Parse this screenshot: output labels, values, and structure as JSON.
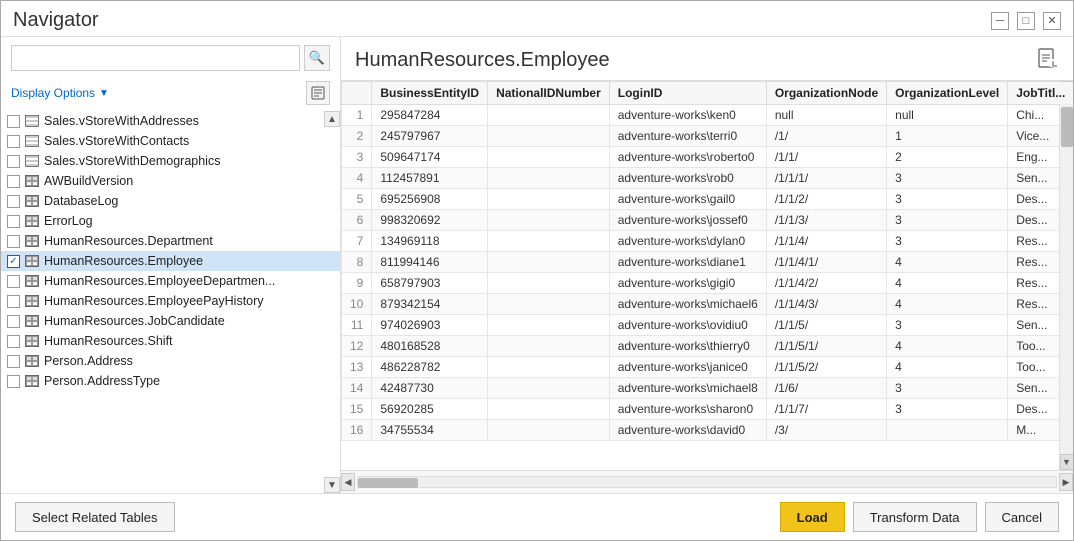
{
  "window": {
    "title": "Navigator",
    "minimize_label": "─",
    "restore_label": "□",
    "close_label": "✕"
  },
  "search": {
    "placeholder": "",
    "value": ""
  },
  "display_options": {
    "label": "Display Options",
    "arrow": "▼"
  },
  "tree": {
    "items": [
      {
        "id": "SalesVStoreWithAddresses",
        "label": "Sales.vStoreWithAddresses",
        "type": "view",
        "checked": false,
        "selected": false
      },
      {
        "id": "SalesVStoreWithContacts",
        "label": "Sales.vStoreWithContacts",
        "type": "view",
        "checked": false,
        "selected": false
      },
      {
        "id": "SalesVStoreWithDemographics",
        "label": "Sales.vStoreWithDemographics",
        "type": "view",
        "checked": false,
        "selected": false
      },
      {
        "id": "AWBuildVersion",
        "label": "AWBuildVersion",
        "type": "table",
        "checked": false,
        "selected": false
      },
      {
        "id": "DatabaseLog",
        "label": "DatabaseLog",
        "type": "table",
        "checked": false,
        "selected": false
      },
      {
        "id": "ErrorLog",
        "label": "ErrorLog",
        "type": "table",
        "checked": false,
        "selected": false
      },
      {
        "id": "HumanResourcesDepartment",
        "label": "HumanResources.Department",
        "type": "table",
        "checked": false,
        "selected": false
      },
      {
        "id": "HumanResourcesEmployee",
        "label": "HumanResources.Employee",
        "type": "table",
        "checked": true,
        "selected": true
      },
      {
        "id": "HumanResourcesEmployeeDepartment",
        "label": "HumanResources.EmployeeDepartmen...",
        "type": "table",
        "checked": false,
        "selected": false
      },
      {
        "id": "HumanResourcesEmployeePayHistory",
        "label": "HumanResources.EmployeePayHistory",
        "type": "table",
        "checked": false,
        "selected": false
      },
      {
        "id": "HumanResourcesJobCandidate",
        "label": "HumanResources.JobCandidate",
        "type": "table",
        "checked": false,
        "selected": false
      },
      {
        "id": "HumanResourcesShift",
        "label": "HumanResources.Shift",
        "type": "table",
        "checked": false,
        "selected": false
      },
      {
        "id": "PersonAddress",
        "label": "Person.Address",
        "type": "table",
        "checked": false,
        "selected": false
      },
      {
        "id": "PersonAddressType",
        "label": "Person.AddressType",
        "type": "table",
        "checked": false,
        "selected": false
      }
    ]
  },
  "data_view": {
    "title": "HumanResources.Employee",
    "columns": [
      "",
      "BusinessEntityID",
      "NationalIDNumber",
      "LoginID",
      "OrganizationNode",
      "OrganizationLevel",
      "JobTitl..."
    ],
    "rows": [
      {
        "num": 1,
        "BusinessEntityID": "295847284",
        "NationalIDNumber": "",
        "LoginID": "adventure-works\\ken0",
        "OrganizationNode": "null",
        "OrganizationLevel": "null",
        "JobTitle": "Chi..."
      },
      {
        "num": 2,
        "BusinessEntityID": "245797967",
        "NationalIDNumber": "",
        "LoginID": "adventure-works\\terri0",
        "OrganizationNode": "/1/",
        "OrganizationLevel": "1",
        "JobTitle": "Vice..."
      },
      {
        "num": 3,
        "BusinessEntityID": "509647174",
        "NationalIDNumber": "",
        "LoginID": "adventure-works\\roberto0",
        "OrganizationNode": "/1/1/",
        "OrganizationLevel": "2",
        "JobTitle": "Eng..."
      },
      {
        "num": 4,
        "BusinessEntityID": "112457891",
        "NationalIDNumber": "",
        "LoginID": "adventure-works\\rob0",
        "OrganizationNode": "/1/1/1/",
        "OrganizationLevel": "3",
        "JobTitle": "Sen..."
      },
      {
        "num": 5,
        "BusinessEntityID": "695256908",
        "NationalIDNumber": "",
        "LoginID": "adventure-works\\gail0",
        "OrganizationNode": "/1/1/2/",
        "OrganizationLevel": "3",
        "JobTitle": "Des..."
      },
      {
        "num": 6,
        "BusinessEntityID": "998320692",
        "NationalIDNumber": "",
        "LoginID": "adventure-works\\jossef0",
        "OrganizationNode": "/1/1/3/",
        "OrganizationLevel": "3",
        "JobTitle": "Des..."
      },
      {
        "num": 7,
        "BusinessEntityID": "134969118",
        "NationalIDNumber": "",
        "LoginID": "adventure-works\\dylan0",
        "OrganizationNode": "/1/1/4/",
        "OrganizationLevel": "3",
        "JobTitle": "Res..."
      },
      {
        "num": 8,
        "BusinessEntityID": "811994146",
        "NationalIDNumber": "",
        "LoginID": "adventure-works\\diane1",
        "OrganizationNode": "/1/1/4/1/",
        "OrganizationLevel": "4",
        "JobTitle": "Res..."
      },
      {
        "num": 9,
        "BusinessEntityID": "658797903",
        "NationalIDNumber": "",
        "LoginID": "adventure-works\\gigi0",
        "OrganizationNode": "/1/1/4/2/",
        "OrganizationLevel": "4",
        "JobTitle": "Res..."
      },
      {
        "num": 10,
        "BusinessEntityID": "879342154",
        "NationalIDNumber": "",
        "LoginID": "adventure-works\\michael6",
        "OrganizationNode": "/1/1/4/3/",
        "OrganizationLevel": "4",
        "JobTitle": "Res..."
      },
      {
        "num": 11,
        "BusinessEntityID": "974026903",
        "NationalIDNumber": "",
        "LoginID": "adventure-works\\ovidiu0",
        "OrganizationNode": "/1/1/5/",
        "OrganizationLevel": "3",
        "JobTitle": "Sen..."
      },
      {
        "num": 12,
        "BusinessEntityID": "480168528",
        "NationalIDNumber": "",
        "LoginID": "adventure-works\\thierry0",
        "OrganizationNode": "/1/1/5/1/",
        "OrganizationLevel": "4",
        "JobTitle": "Too..."
      },
      {
        "num": 13,
        "BusinessEntityID": "486228782",
        "NationalIDNumber": "",
        "LoginID": "adventure-works\\janice0",
        "OrganizationNode": "/1/1/5/2/",
        "OrganizationLevel": "4",
        "JobTitle": "Too..."
      },
      {
        "num": 14,
        "BusinessEntityID": "42487730",
        "NationalIDNumber": "",
        "LoginID": "adventure-works\\michael8",
        "OrganizationNode": "/1/6/",
        "OrganizationLevel": "3",
        "JobTitle": "Sen..."
      },
      {
        "num": 15,
        "BusinessEntityID": "56920285",
        "NationalIDNumber": "",
        "LoginID": "adventure-works\\sharon0",
        "OrganizationNode": "/1/1/7/",
        "OrganizationLevel": "3",
        "JobTitle": "Des..."
      },
      {
        "num": 16,
        "BusinessEntityID": "34755534",
        "NationalIDNumber": "",
        "LoginID": "adventure-works\\david0",
        "OrganizationNode": "/3/",
        "OrganizationLevel": "",
        "JobTitle": "M..."
      }
    ]
  },
  "bottom": {
    "select_related_tables": "Select Related Tables",
    "load": "Load",
    "transform_data": "Transform Data",
    "cancel": "Cancel"
  }
}
